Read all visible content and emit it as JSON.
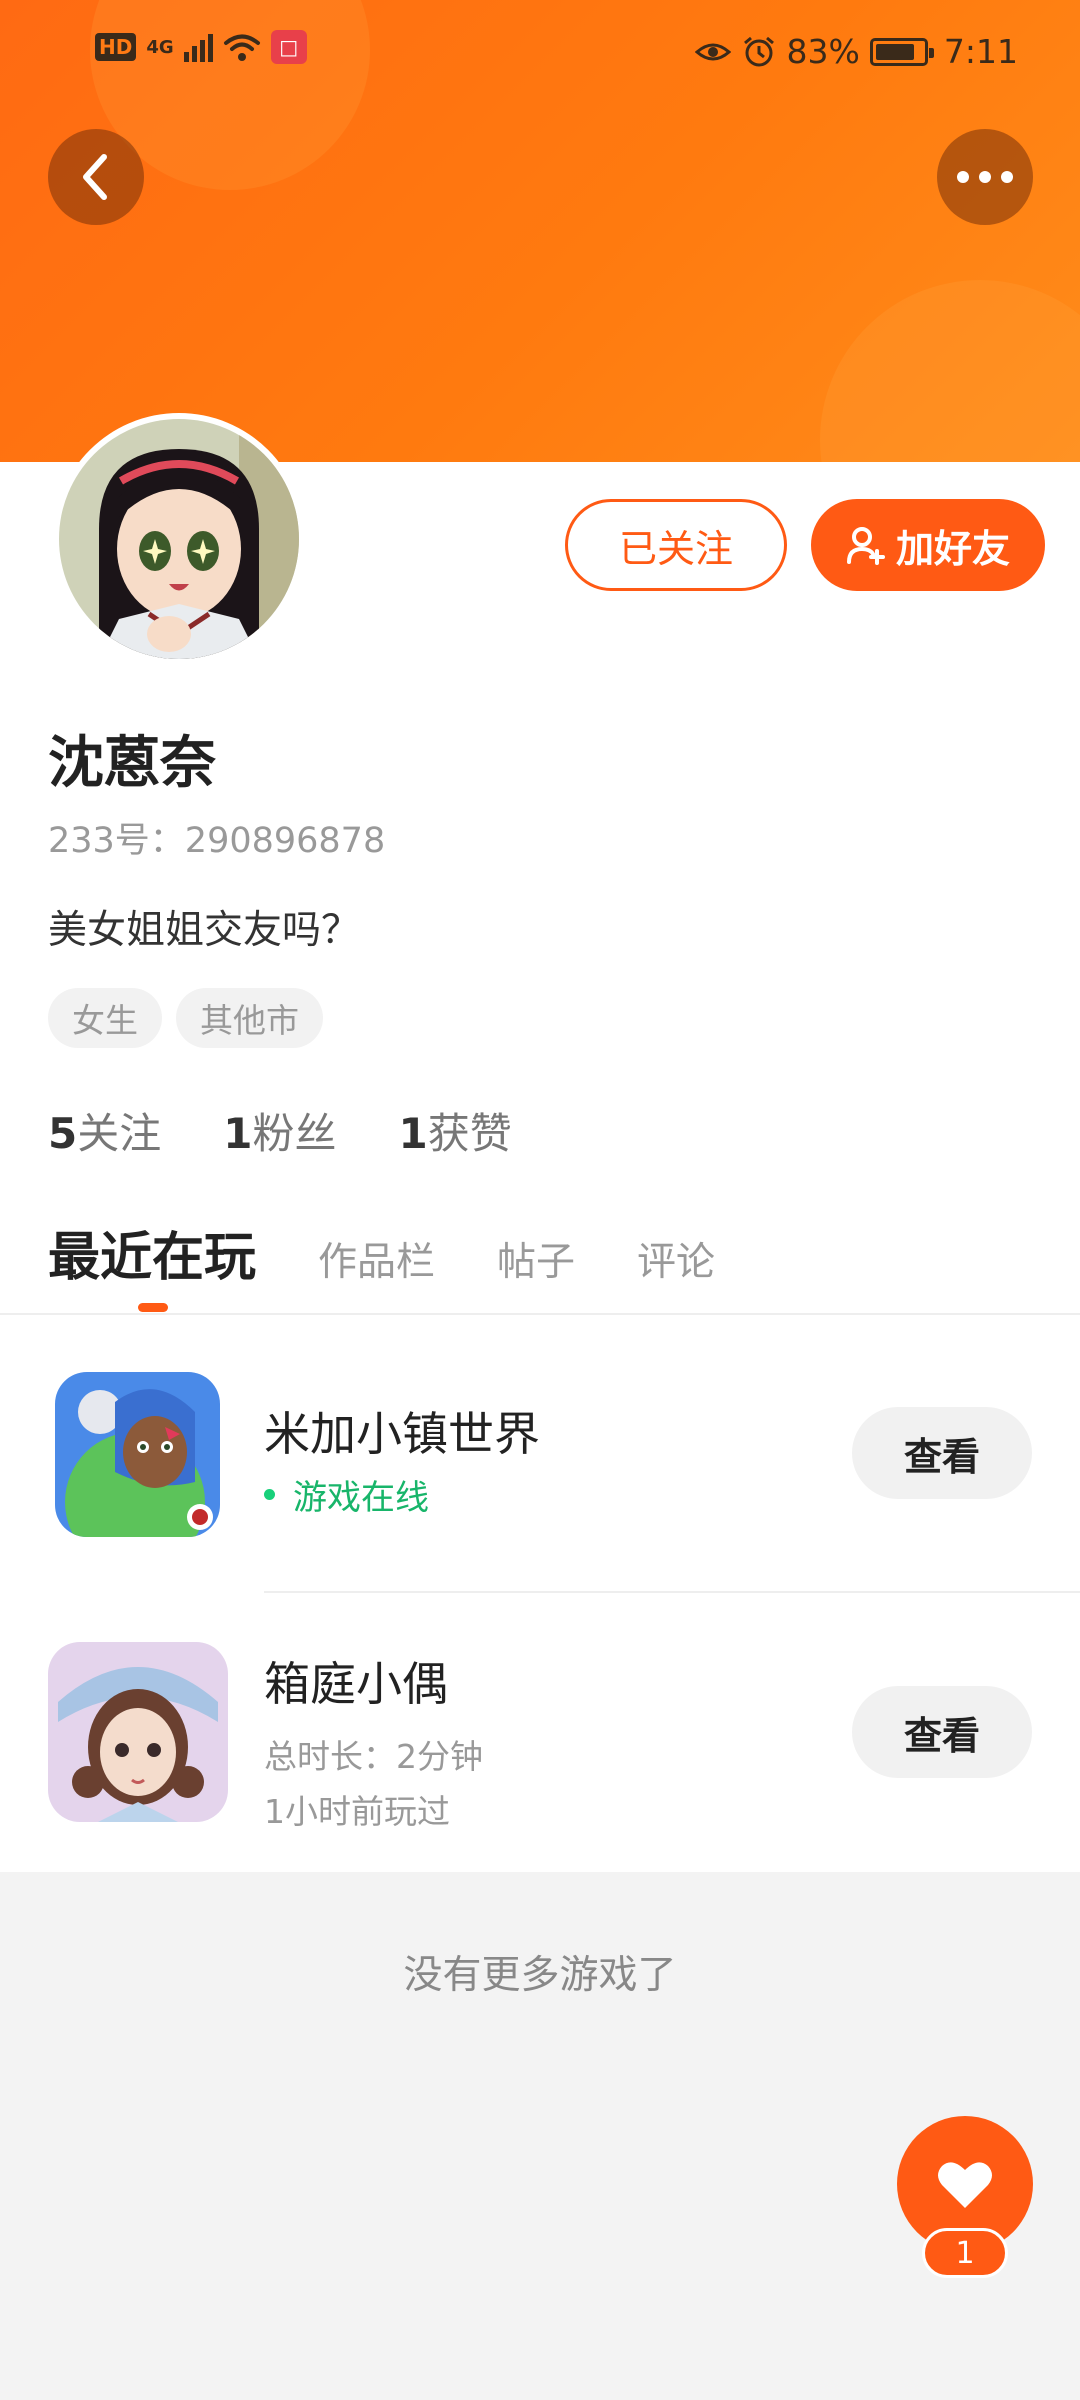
{
  "status_bar": {
    "hd": "HD",
    "network": "4G",
    "battery": "83%",
    "time": "7:11"
  },
  "profile": {
    "name": "沈蒽奈",
    "id_text": "233号：290896878",
    "bio": "美女姐姐交友吗？",
    "tags": [
      "女生",
      "其他市"
    ],
    "followed_label": "已关注",
    "add_friend_label": "加好友"
  },
  "stats": [
    {
      "count": "5",
      "label": "关注"
    },
    {
      "count": "1",
      "label": "粉丝"
    },
    {
      "count": "1",
      "label": "获赞"
    }
  ],
  "tabs": [
    "最近在玩",
    "作品栏",
    "帖子",
    "评论"
  ],
  "games": [
    {
      "title": "米加小镇世界",
      "status": "游戏在线",
      "button": "查看"
    },
    {
      "title": "箱庭小偶",
      "duration": "总时长：2分钟",
      "last_played": "1小时前玩过",
      "button": "查看"
    }
  ],
  "footer": {
    "no_more": "没有更多游戏了"
  },
  "like": {
    "count": "1"
  },
  "colors": {
    "accent": "#ff5a14",
    "online": "#18b56a"
  }
}
